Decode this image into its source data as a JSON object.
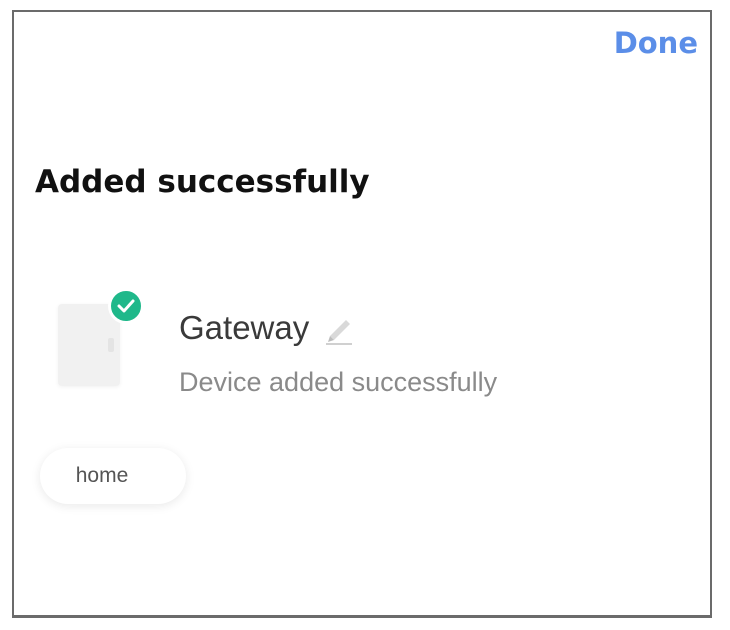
{
  "header": {
    "done_label": "Done"
  },
  "main": {
    "title": "Added successfully",
    "device": {
      "name": "Gateway",
      "status": "Device added successfully",
      "icon": "gateway-device-icon",
      "badge_icon": "check-icon",
      "edit_icon": "pencil-icon"
    },
    "room_chip": {
      "label": "home"
    }
  },
  "colors": {
    "accent": "#5b8ee8",
    "success": "#1fb88a",
    "title_text": "#111111",
    "secondary_text": "#8a8a8a"
  }
}
